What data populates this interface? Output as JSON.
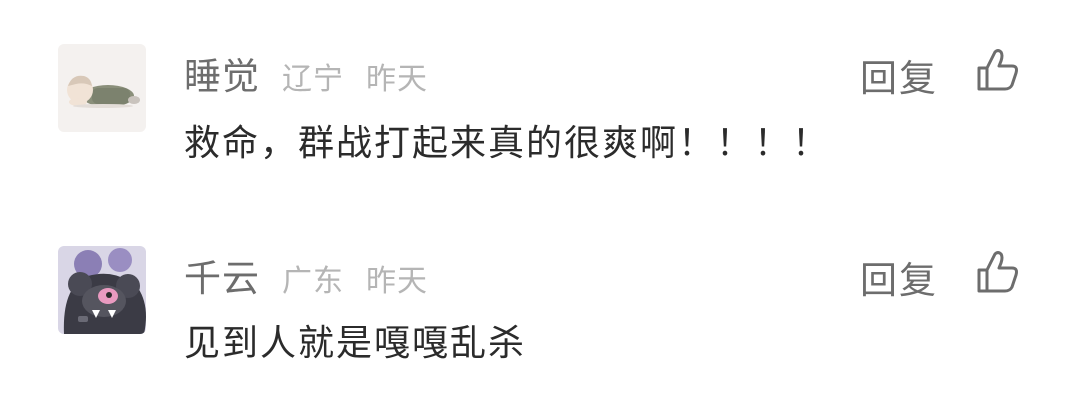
{
  "comments": [
    {
      "username": "睡觉",
      "region": "辽宁",
      "time": "昨天",
      "reply_label": "回复",
      "text": "救命，群战打起来真的很爽啊！！！！",
      "avatar_icon": "sleeping-character-avatar"
    },
    {
      "username": "千云",
      "region": "广东",
      "time": "昨天",
      "reply_label": "回复",
      "text": "见到人就是嘎嘎乱杀",
      "avatar_icon": "dark-creature-avatar"
    }
  ],
  "colors": {
    "username": "#6d6d6d",
    "meta": "#b5b5b5",
    "text": "#2b2b2b",
    "icon": "#6d6d6d"
  }
}
